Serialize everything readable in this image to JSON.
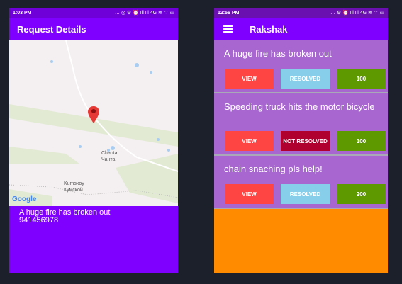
{
  "left": {
    "status_time": "1:03 PM",
    "status_icons": "… ◎ ⚙ ⏰ ıll ıll 4G ≋ ⌔ ▭",
    "title": "Request Details",
    "map": {
      "labels": [
        {
          "en": "Chanta",
          "ru": "Чанта"
        },
        {
          "en": "Kumskoy",
          "ru": "Кумской"
        }
      ],
      "logo": "Google",
      "pin_color": "#e53935"
    },
    "details": {
      "description": "A huge fire has broken out",
      "phone": "941456978"
    }
  },
  "right": {
    "status_time": "12:56 PM",
    "status_icons": "… ⚙ ⏰ ıll ıll 4G ≋ ⌔ ▭",
    "title": "Rakshak",
    "cards": [
      {
        "title": "A huge fire has broken out",
        "view": "VIEW",
        "status": "RESOLVED",
        "status_color": "#87ceeb",
        "count": "100"
      },
      {
        "title": "Speeding truck hits the motor bicycle",
        "view": "VIEW",
        "status": "NOT RESOLVED",
        "status_color": "#b00030",
        "count": "100"
      },
      {
        "title": "chain snaching pls help!",
        "view": "VIEW",
        "status": "RESOLVED",
        "status_color": "#87ceeb",
        "count": "200"
      }
    ]
  },
  "colors": {
    "primary": "#8000ff",
    "card": "#a866d0",
    "view": "#ff4444",
    "count": "#5f9900",
    "footer": "#ff8c00"
  }
}
